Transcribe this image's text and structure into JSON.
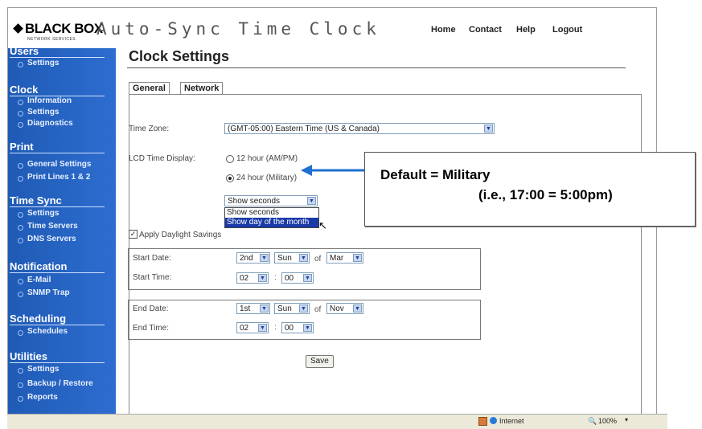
{
  "header": {
    "logo_text": "BLACK BOX",
    "logo_subtext": "NETWORK SERVICES",
    "app_title": "Auto-Sync Time Clock",
    "nav": [
      "Home",
      "Contact",
      "Help",
      "Logout"
    ]
  },
  "sidebar": {
    "sections": [
      {
        "title": "Users",
        "items": [
          "Settings"
        ]
      },
      {
        "title": "Clock",
        "items": [
          "Information",
          "Settings",
          "Diagnostics"
        ]
      },
      {
        "title": "Print",
        "items": [
          "General Settings",
          "Print Lines 1 & 2"
        ]
      },
      {
        "title": "Time Sync",
        "items": [
          "Settings",
          "Time Servers",
          "DNS Servers"
        ]
      },
      {
        "title": "Notification",
        "items": [
          "E-Mail",
          "SNMP Trap"
        ]
      },
      {
        "title": "Scheduling",
        "items": [
          "Schedules"
        ]
      },
      {
        "title": "Utilities",
        "items": [
          "Settings",
          "Backup / Restore",
          "Reports"
        ]
      }
    ]
  },
  "main": {
    "title": "Clock Settings",
    "tabs": [
      "General",
      "Network"
    ],
    "timezone": {
      "label": "Time Zone:",
      "value": "(GMT-05:00) Eastern Time (US & Canada)"
    },
    "lcd": {
      "label": "LCD Time Display:",
      "opt12": "12 hour (AM/PM)",
      "opt24": "24 hour (Military)",
      "seconds_select": "Show seconds",
      "dropdown_options": [
        "Show seconds",
        "Show day of the month"
      ]
    },
    "dst": {
      "label": "Apply Daylight Savings",
      "checked": true
    },
    "start": {
      "date_label": "Start Date:",
      "week": "2nd",
      "day": "Sun",
      "of": "of",
      "month": "Mar",
      "time_label": "Start Time:",
      "hour": "02",
      "colon": ":",
      "minute": "00"
    },
    "end": {
      "date_label": "End Date:",
      "week": "1st",
      "day": "Sun",
      "of": "of",
      "month": "Nov",
      "time_label": "End Time:",
      "hour": "02",
      "colon": ":",
      "minute": "00"
    },
    "save": "Save"
  },
  "statusbar": {
    "zone": "Internet",
    "zoom": "100%"
  },
  "callout": {
    "line1": "Default = Military",
    "line2": "(i.e., 17:00 = 5:00pm)"
  },
  "colors": {
    "sidebar": "#2e6dd0",
    "arrow": "#1f6fd1",
    "dropdown_highlight": "#1a3aa8"
  }
}
